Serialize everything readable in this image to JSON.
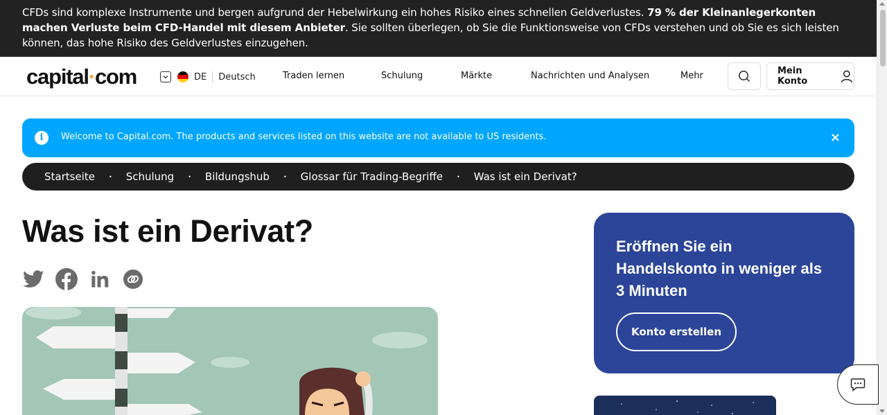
{
  "risk_banner": {
    "text_pre": "CFDs sind komplexe Instrumente und bergen aufgrund der Hebelwirkung ein hohes Risiko eines schnellen Geldverlustes. ",
    "text_bold": "79 % der Kleinanlegerkonten machen Verluste beim CFD-Handel mit diesem Anbieter",
    "text_post": ". Sie sollten überlegen, ob Sie die Funktionsweise von CFDs verstehen und ob Sie es sich leisten können, das hohe Risiko des Geldverlustes einzugehen."
  },
  "header": {
    "logo_part1": "capital",
    "logo_dot": "·",
    "logo_part2": "com",
    "lang_code": "DE",
    "lang_name": "Deutsch",
    "nav": [
      "Traden lernen",
      "Schulung",
      "Märkte",
      "Nachrichten und Analysen",
      "Mehr"
    ],
    "account_label": "Mein Konto"
  },
  "welcome": {
    "message": "Welcome to Capital.com. The products and services listed on this website are not available to US residents.",
    "close": "×"
  },
  "breadcrumb": [
    "Startseite",
    "Schulung",
    "Bildungshub",
    "Glossar für Trading-Begriffe",
    "Was ist ein Derivat?"
  ],
  "breadcrumb_sep": "•",
  "page": {
    "title": "Was ist ein Derivat?"
  },
  "share_icons": [
    "twitter-icon",
    "facebook-icon",
    "linkedin-icon",
    "copy-link-icon"
  ],
  "signup_card": {
    "title": "Eröffnen Sie ein Handelskonto in weniger als 3 Minuten",
    "button": "Konto erstellen"
  },
  "colors": {
    "risk_bg": "#222222",
    "welcome_bg": "#00a6ff",
    "breadcrumb_bg": "#1f1f1f",
    "card_bg": "#2c4598",
    "logo_dot": "#f2a43a",
    "hero_bg": "#a3c6b7"
  }
}
